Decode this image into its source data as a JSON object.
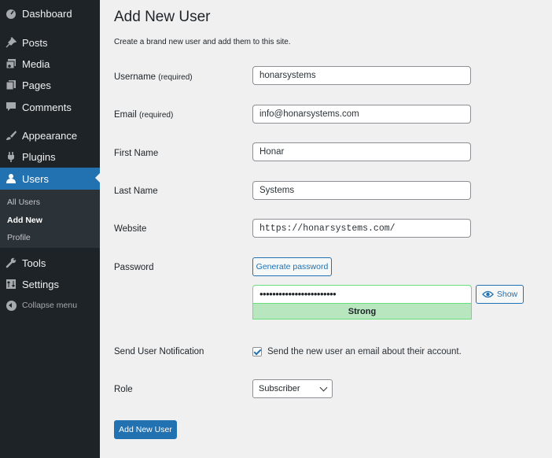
{
  "colors": {
    "sidebar_bg": "#1d2327",
    "accent": "#2271b1",
    "strength_bg": "#b8e6bf",
    "strength_border": "#68de7c"
  },
  "sidebar": {
    "items": [
      {
        "label": "Dashboard",
        "icon": "dashboard-icon"
      },
      {
        "label": "Posts",
        "icon": "pin-icon"
      },
      {
        "label": "Media",
        "icon": "media-icon"
      },
      {
        "label": "Pages",
        "icon": "pages-icon"
      },
      {
        "label": "Comments",
        "icon": "comment-icon"
      },
      {
        "label": "Appearance",
        "icon": "brush-icon"
      },
      {
        "label": "Plugins",
        "icon": "plug-icon"
      },
      {
        "label": "Users",
        "icon": "user-icon",
        "active": true
      },
      {
        "label": "Tools",
        "icon": "wrench-icon"
      },
      {
        "label": "Settings",
        "icon": "settings-icon"
      }
    ],
    "submenu": [
      "All Users",
      "Add New",
      "Profile"
    ],
    "collapse_label": "Collapse menu"
  },
  "page": {
    "title": "Add New User",
    "description": "Create a brand new user and add them to this site."
  },
  "form": {
    "username": {
      "label": "Username",
      "req": "(required)",
      "value": "honarsystems"
    },
    "email": {
      "label": "Email",
      "req": "(required)",
      "value": "info@honarsystems.com"
    },
    "first_name": {
      "label": "First Name",
      "value": "Honar"
    },
    "last_name": {
      "label": "Last Name",
      "value": "Systems"
    },
    "website": {
      "label": "Website",
      "value": "https://honarsystems.com/"
    },
    "password": {
      "label": "Password",
      "generate_label": "Generate password",
      "masked_value": "••••••••••••••••••••••••",
      "show_label": "Show",
      "strength": "Strong"
    },
    "notification": {
      "label": "Send User Notification",
      "checkbox_label": "Send the new user an email about their account.",
      "checked": true
    },
    "role": {
      "label": "Role",
      "value": "Subscriber"
    },
    "submit_label": "Add New User"
  }
}
